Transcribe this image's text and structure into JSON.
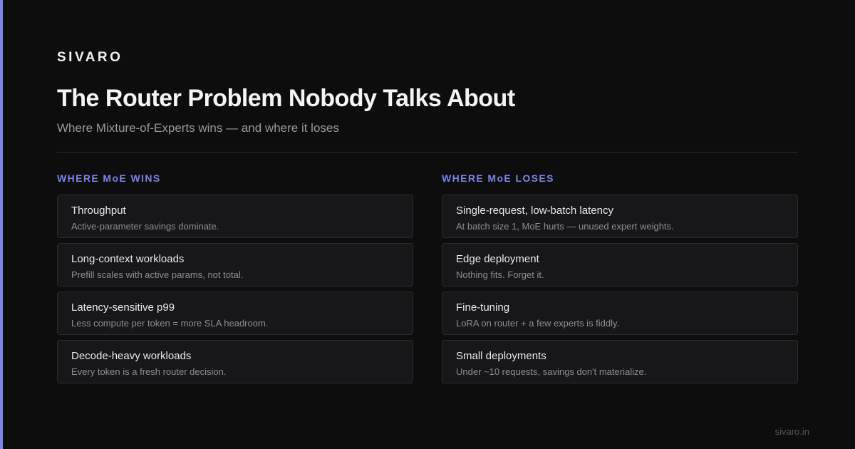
{
  "brand": "SIVARO",
  "title": "The Router Problem Nobody Talks About",
  "subtitle": "Where Mixture-of-Experts wins — and where it loses",
  "colors": {
    "accent": "#7b85e8",
    "background": "#0d0d0d",
    "card": "#17171a"
  },
  "wins": {
    "heading": "WHERE MoE WINS",
    "items": [
      {
        "title": "Throughput",
        "desc": "Active-parameter savings dominate."
      },
      {
        "title": "Long-context workloads",
        "desc": "Prefill scales with active params, not total."
      },
      {
        "title": "Latency-sensitive p99",
        "desc": "Less compute per token = more SLA headroom."
      },
      {
        "title": "Decode-heavy workloads",
        "desc": "Every token is a fresh router decision."
      }
    ]
  },
  "loses": {
    "heading": "WHERE MoE LOSES",
    "items": [
      {
        "title": "Single-request, low-batch latency",
        "desc": "At batch size 1, MoE hurts — unused expert weights."
      },
      {
        "title": "Edge deployment",
        "desc": "Nothing fits. Forget it."
      },
      {
        "title": "Fine-tuning",
        "desc": "LoRA on router + a few experts is fiddly."
      },
      {
        "title": "Small deployments",
        "desc": "Under ~10 requests, savings don't materialize."
      }
    ]
  },
  "footer": "sivaro.in"
}
